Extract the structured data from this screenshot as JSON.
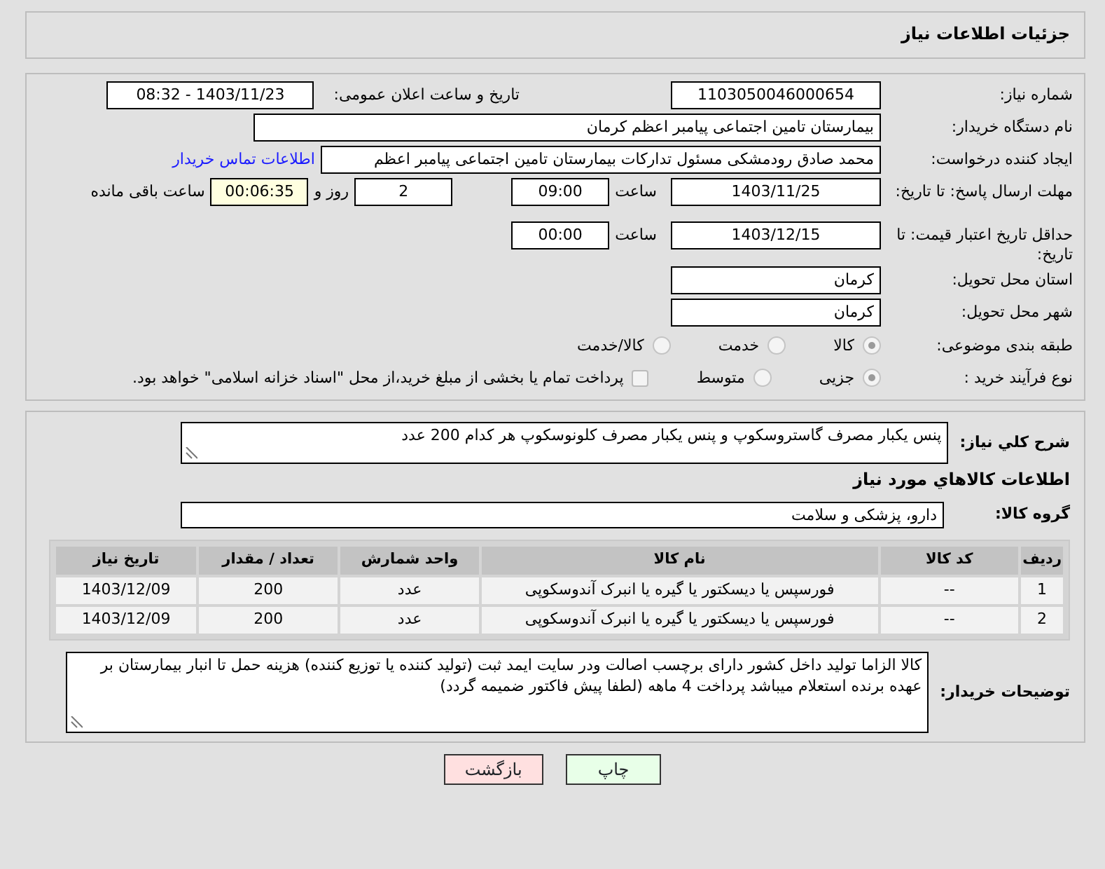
{
  "header": {
    "title": "جزئیات اطلاعات نیاز"
  },
  "need_number": {
    "label": "شماره نیاز:",
    "value": "1103050046000654"
  },
  "announce_datetime": {
    "label": "تاریخ و ساعت اعلان عمومی:",
    "value": "1403/11/23 - 08:32"
  },
  "buyer_org": {
    "label": "نام دستگاه خریدار:",
    "value": "بیمارستان تامین اجتماعی پیامبر اعظم کرمان"
  },
  "requester": {
    "label": "ایجاد کننده درخواست:",
    "value": "محمد صادق  رودمشکی مسئول تدارکات بیمارستان تامین اجتماعی پیامبر اعظم",
    "link": "اطلاعات تماس خریدار"
  },
  "response_deadline": {
    "label": "مهلت ارسال پاسخ: تا تاریخ:",
    "date": "1403/11/25",
    "time_label": "ساعت",
    "time": "09:00",
    "days": "2",
    "days_label": "روز و",
    "remaining": "00:06:35",
    "remaining_label": "ساعت باقی مانده"
  },
  "price_validity": {
    "label": "حداقل تاریخ اعتبار قیمت: تا تاریخ:",
    "date": "1403/12/15",
    "time_label": "ساعت",
    "time": "00:00"
  },
  "province": {
    "label": "استان محل تحویل:",
    "value": "کرمان"
  },
  "city": {
    "label": "شهر محل تحویل:",
    "value": "کرمان"
  },
  "category": {
    "label": "طبقه بندی موضوعی:",
    "options": [
      {
        "label": "کالا",
        "selected": true
      },
      {
        "label": "خدمت",
        "selected": false
      },
      {
        "label": "کالا/خدمت",
        "selected": false
      }
    ]
  },
  "purchase_process": {
    "label": "نوع فرآیند خرید :",
    "options": [
      {
        "label": "جزیی",
        "selected": true
      },
      {
        "label": "متوسط",
        "selected": false
      }
    ],
    "payment_note": {
      "label": "پرداخت تمام یا بخشی از مبلغ خرید،از محل \"اسناد خزانه اسلامی\" خواهد بود.",
      "checked": false
    }
  },
  "description": {
    "label": "شرح کلي نياز:",
    "value": "پنس یکبار مصرف گاستروسکوپ و پنس یکبار مصرف کلونوسکوپ هر کدام 200 عدد"
  },
  "items_heading": "اطلاعات کالاهاي مورد نياز",
  "goods_group": {
    "label": "گروه کالا:",
    "value": "دارو، پزشکی و سلامت"
  },
  "table": {
    "columns": [
      "ردیف",
      "کد کالا",
      "نام کالا",
      "واحد شمارش",
      "تعداد / مقدار",
      "تاریخ نیاز"
    ],
    "rows": [
      [
        "1",
        "--",
        "فورسپس یا دیسکتور یا گیره یا انبرک آندوسکوپی",
        "عدد",
        "200",
        "1403/12/09"
      ],
      [
        "2",
        "--",
        "فورسپس یا دیسکتور یا گیره یا انبرک آندوسکوپی",
        "عدد",
        "200",
        "1403/12/09"
      ]
    ]
  },
  "buyer_notes": {
    "label": "توضیحات خریدار:",
    "value": "کالا الزاما تولید داخل کشور دارای برچسب اصالت ودر سایت ایمد ثبت (تولید کننده یا توزیع کننده) هزینه حمل تا انبار بیمارستان بر عهده برنده استعلام میباشد پرداخت 4 ماهه (لطفا پیش فاکتور ضمیمه گردد)"
  },
  "buttons": [
    {
      "label": "چاپ",
      "kind": "print"
    },
    {
      "label": "بازگشت",
      "kind": "back"
    }
  ]
}
